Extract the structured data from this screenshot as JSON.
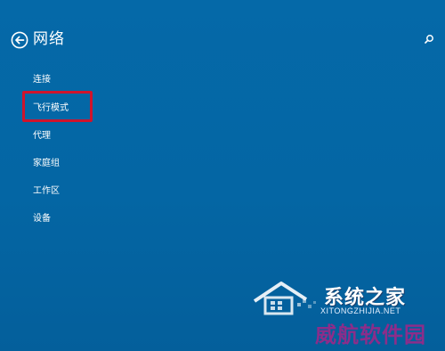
{
  "header": {
    "title": "网络",
    "back_icon": "back-arrow-icon",
    "search_icon": "search-icon"
  },
  "nav": {
    "items": [
      {
        "label": "连接"
      },
      {
        "label": "飞行模式",
        "highlighted": true
      },
      {
        "label": "代理"
      },
      {
        "label": "家庭组"
      },
      {
        "label": "工作区"
      },
      {
        "label": "设备"
      }
    ]
  },
  "watermark": {
    "brand": "系统之家",
    "url": "XITONGZHIJIA.NET",
    "sub": "威航软件园"
  },
  "colors": {
    "background": "#0466a4",
    "text": "#ffffff",
    "highlight": "#d0142c",
    "watermark_sub": "#8c2d8a"
  }
}
